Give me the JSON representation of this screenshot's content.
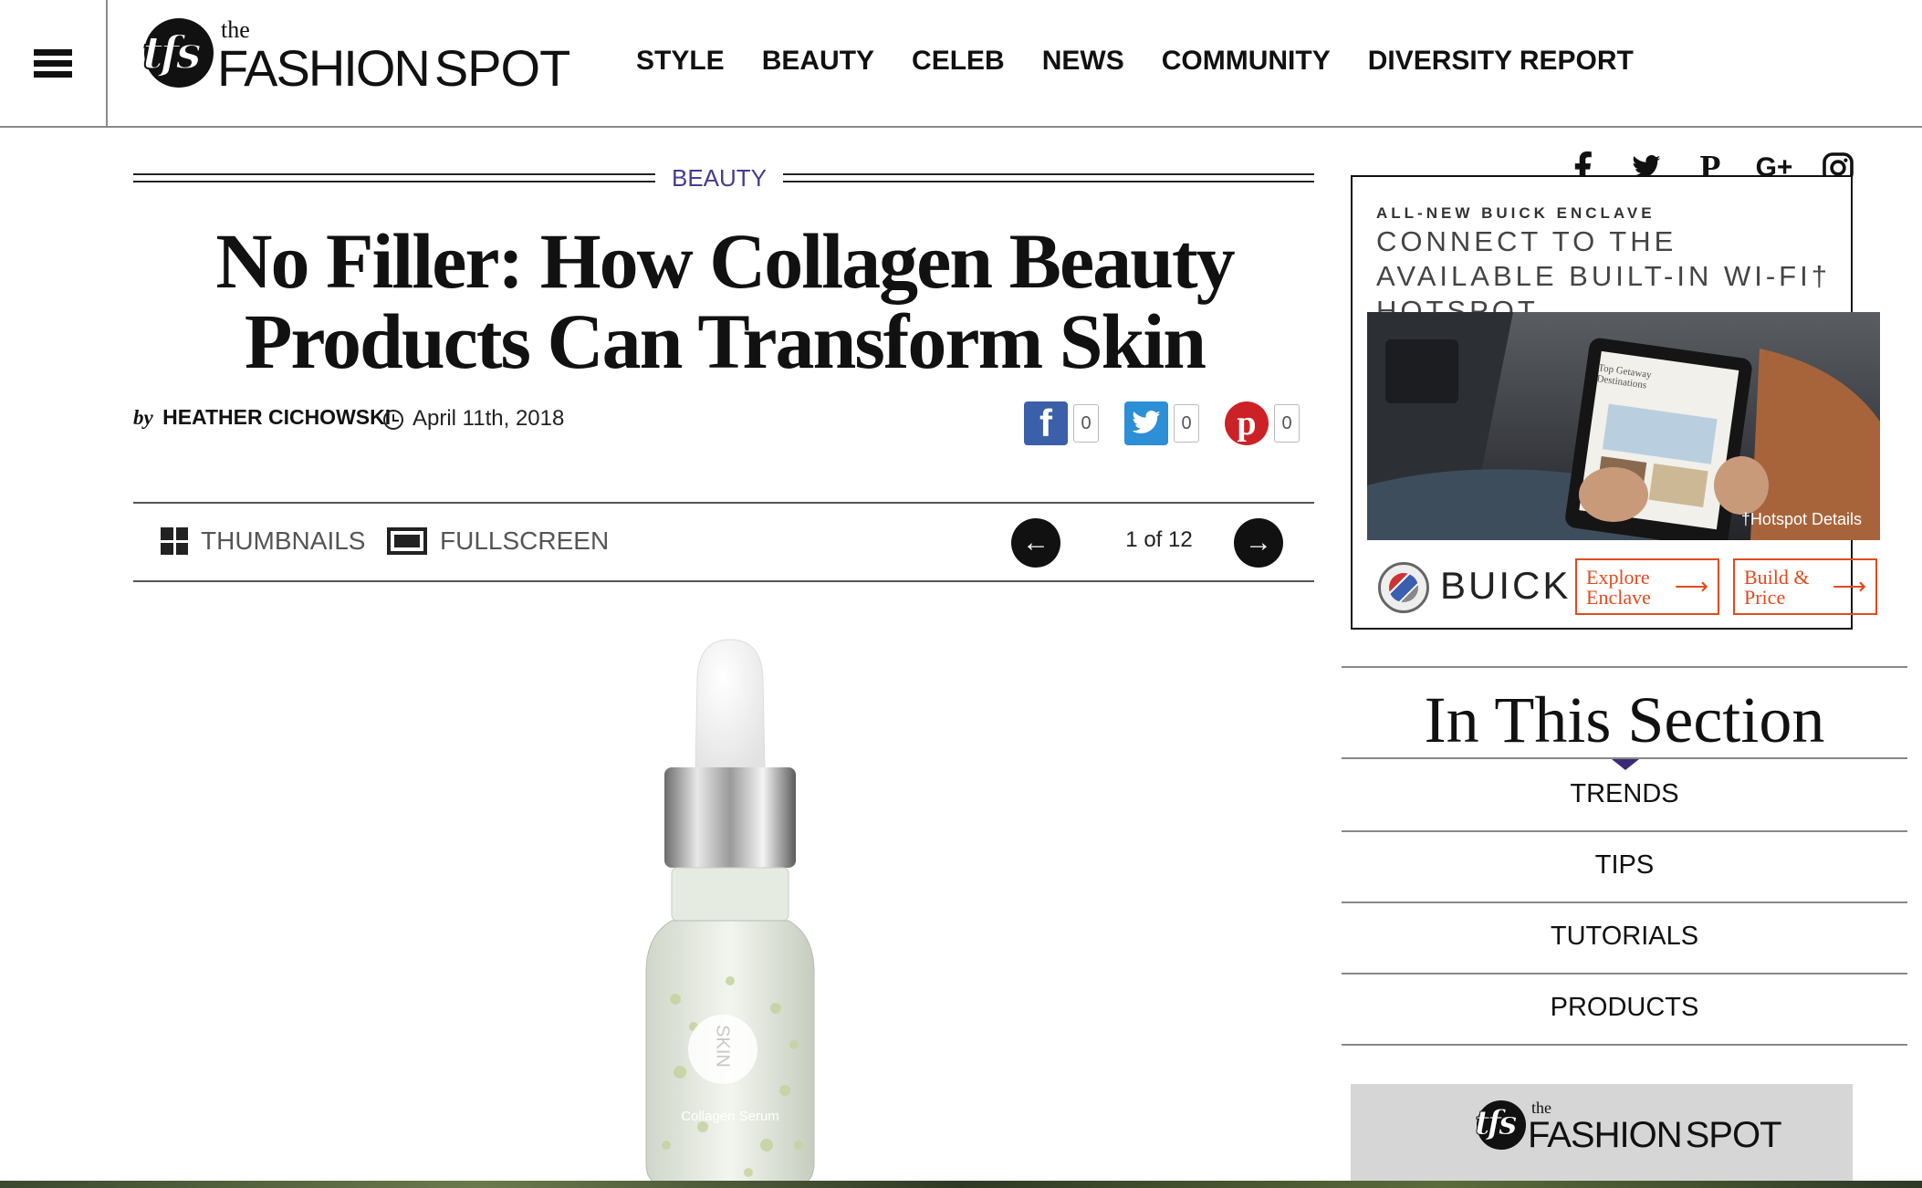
{
  "header": {
    "logo": {
      "small": "the",
      "mark": "tfs",
      "word1": "FASHION",
      "word2": "SPOT"
    },
    "nav": [
      "STYLE",
      "BEAUTY",
      "CELEB",
      "NEWS",
      "COMMUNITY",
      "DIVERSITY REPORT"
    ]
  },
  "article": {
    "section": "BEAUTY",
    "title": "No Filler: How Collagen Beauty Products Can Transform Skin",
    "by": "by",
    "author": "HEATHER CICHOWSKI",
    "date": "April 11th, 2018",
    "shares": {
      "facebook": "0",
      "twitter": "0",
      "pinterest": "0"
    }
  },
  "gallery": {
    "thumbnails_label": "THUMBNAILS",
    "fullscreen_label": "FULLSCREEN",
    "prev_symbol": "←",
    "next_symbol": "→",
    "counter": "1 of 12",
    "product_label": "Collagen Serum",
    "product_brand": "SKIN"
  },
  "social": [
    "f",
    "twitter",
    "P",
    "G+",
    "instagram"
  ],
  "ad": {
    "kicker": "ALL-NEW BUICK ENCLAVE",
    "headline": "CONNECT TO THE AVAILABLE BUILT-IN WI-FI† HOTSPOT",
    "tablet_title": "Top Getaway Destinations",
    "hotspot_link": "†Hotspot Details",
    "brand": "BUICK",
    "cta1": "Explore Enclave",
    "cta2": "Build & Price",
    "accent": "#e04b1f"
  },
  "in_this_section": {
    "heading": "In This Section",
    "links": [
      "TRENDS",
      "TIPS",
      "TUTORIALS",
      "PRODUCTS"
    ]
  },
  "promo": {
    "small": "the",
    "mark": "tfs",
    "word1": "FASHION",
    "word2": "SPOT"
  },
  "colors": {
    "section_purple": "#4a3a8f",
    "caret": "#3c2a78"
  }
}
